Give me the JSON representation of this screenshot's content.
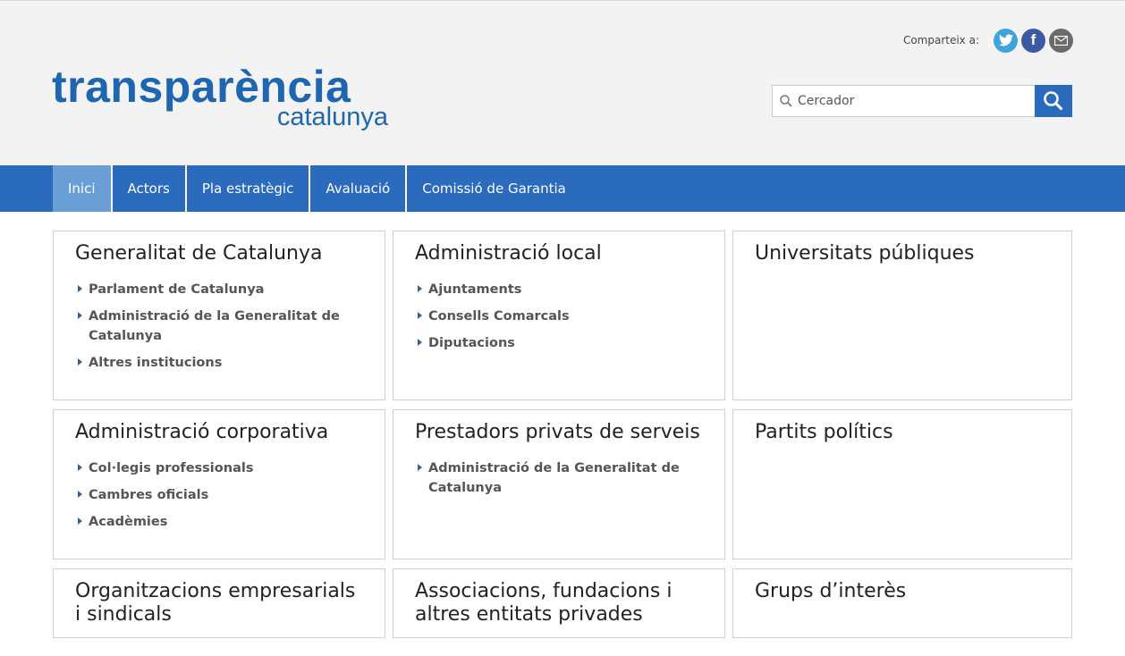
{
  "header": {
    "logo_main": "transparència",
    "logo_sub": "catalunya",
    "share_label": "Comparteix a:",
    "share_buttons": [
      "twitter-icon",
      "facebook-icon",
      "mail-icon"
    ],
    "search_placeholder": "Cercador"
  },
  "nav": {
    "items": [
      {
        "label": "Inici",
        "active": true
      },
      {
        "label": "Actors",
        "active": false
      },
      {
        "label": "Pla estratègic",
        "active": false
      },
      {
        "label": "Avaluació",
        "active": false
      },
      {
        "label": "Comissió de Garantia",
        "active": false
      }
    ]
  },
  "cards": [
    {
      "title": "Generalitat de Catalunya",
      "links": [
        "Parlament de Catalunya",
        "Administració de la Generalitat de Catalunya",
        "Altres institucions"
      ]
    },
    {
      "title": "Administració local",
      "links": [
        "Ajuntaments",
        "Consells Comarcals",
        "Diputacions"
      ]
    },
    {
      "title": "Universitats públiques",
      "links": []
    },
    {
      "title": "Administració corporativa",
      "links": [
        "Col·legis professionals",
        "Cambres oficials",
        "Acadèmies"
      ]
    },
    {
      "title": "Prestadors privats de serveis",
      "links": [
        "Administració de la Generalitat de Catalunya"
      ]
    },
    {
      "title": "Partits polítics",
      "links": []
    },
    {
      "title": "Organitzacions empresarials i sindicals",
      "links": []
    },
    {
      "title": "Associacions, fundacions i altres entitats privades",
      "links": []
    },
    {
      "title": "Grups d’interès",
      "links": []
    }
  ],
  "colors": {
    "brand_blue": "#1f66b1",
    "nav_blue": "#2a6bbd",
    "nav_active": "#6a9fd6"
  }
}
